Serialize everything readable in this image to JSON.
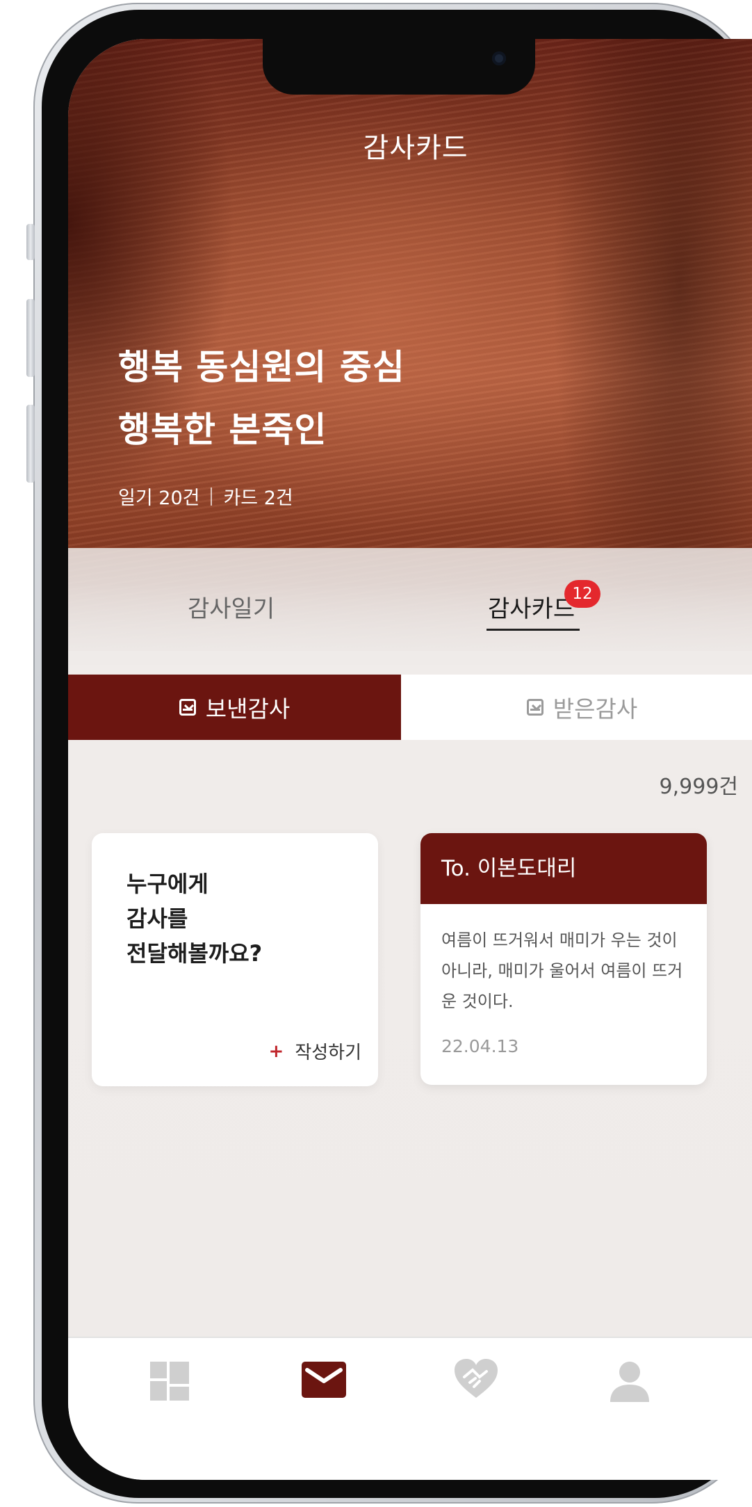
{
  "app": {
    "title": "감사카드"
  },
  "hero": {
    "line1": "행복 동심원의 중심",
    "line2": "행복한 본죽인",
    "diary_count": "일기 20건",
    "card_count": "카드 2건"
  },
  "tabs": {
    "items": [
      {
        "label": "감사일기",
        "active": false
      },
      {
        "label": "감사카드",
        "active": true,
        "badge": "12"
      }
    ]
  },
  "segments": {
    "sent": {
      "label": "보낸감사",
      "selected": true
    },
    "received": {
      "label": "받은감사",
      "selected": false
    }
  },
  "list": {
    "count": "9,999건"
  },
  "write_card": {
    "line1": "누구에게",
    "line2": "감사를",
    "line3": "전달해볼까요?",
    "action": "작성하기"
  },
  "sent_card": {
    "to": "To. 이본도대리",
    "body": "여름이 뜨거워서 매미가 우는 것이 아니라, 매미가 울어서 여름이 뜨거운 것이다.",
    "date": "22.04.13"
  },
  "bottom_nav": {
    "items": [
      {
        "icon": "grid-icon",
        "active": false
      },
      {
        "icon": "mail-icon",
        "active": true
      },
      {
        "icon": "heart-handshake-icon",
        "active": false
      },
      {
        "icon": "user-icon",
        "active": false
      }
    ]
  },
  "colors": {
    "brand": "#6b1510",
    "badge": "#e4282d",
    "inactive_icon": "#cfcfcf"
  }
}
